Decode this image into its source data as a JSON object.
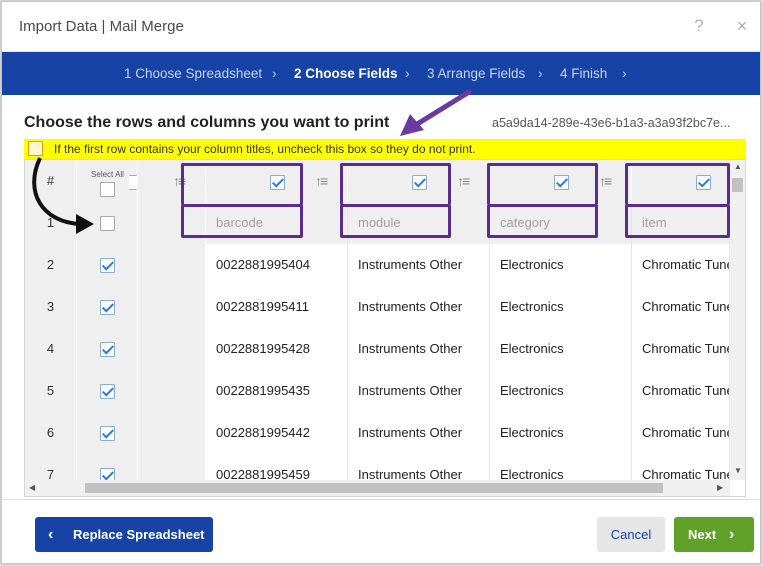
{
  "window": {
    "title": "Import Data | Mail Merge",
    "help_icon": "?",
    "close_icon": "×"
  },
  "steps": [
    {
      "label": "1 Choose Spreadsheet",
      "active": false
    },
    {
      "label": "2 Choose Fields",
      "active": true
    },
    {
      "label": "3 Arrange Fields",
      "active": false
    },
    {
      "label": "4 Finish",
      "active": false
    }
  ],
  "step_separator": "›",
  "main": {
    "heading": "Choose the rows and columns you want to print",
    "document_id": "a5a9da14-289e-43e6-b1a3-a3a93f2bc7e...",
    "first_row_notice": "If the first row contains your column titles, uncheck this box so they do not print.",
    "first_row_checkbox_checked": false
  },
  "grid": {
    "row_number_header": "#",
    "select_all_label": "Select All",
    "select_all_checked": false,
    "sort_icon": "↑≡",
    "columns": [
      {
        "name": "barcode",
        "checked": true
      },
      {
        "name": "module",
        "checked": true
      },
      {
        "name": "category",
        "checked": true
      },
      {
        "name": "item",
        "checked": true
      }
    ],
    "rows": [
      {
        "num": "1",
        "checked": false,
        "is_header_row": true
      },
      {
        "num": "2",
        "checked": true,
        "cells": [
          "0022881995404",
          "Instruments Other",
          "Electronics",
          "Chromatic Tune"
        ]
      },
      {
        "num": "3",
        "checked": true,
        "cells": [
          "0022881995411",
          "Instruments Other",
          "Electronics",
          "Chromatic Tune"
        ]
      },
      {
        "num": "4",
        "checked": true,
        "cells": [
          "0022881995428",
          "Instruments Other",
          "Electronics",
          "Chromatic Tune"
        ]
      },
      {
        "num": "5",
        "checked": true,
        "cells": [
          "0022881995435",
          "Instruments Other",
          "Electronics",
          "Chromatic Tune"
        ]
      },
      {
        "num": "6",
        "checked": true,
        "cells": [
          "0022881995442",
          "Instruments Other",
          "Electronics",
          "Chromatic Tune"
        ]
      },
      {
        "num": "7",
        "checked": true,
        "cells": [
          "0022881995459",
          "Instruments Other",
          "Electronics",
          "Chromatic Tune"
        ]
      }
    ]
  },
  "footer": {
    "replace_label": "Replace Spreadsheet",
    "cancel_label": "Cancel",
    "next_label": "Next",
    "back_chevron": "‹",
    "next_chevron": "›"
  },
  "colors": {
    "brand_blue": "#1643a5",
    "next_green": "#61a12a",
    "notice_yellow": "#ffff00",
    "annotation_purple": "#5a2d8c"
  }
}
